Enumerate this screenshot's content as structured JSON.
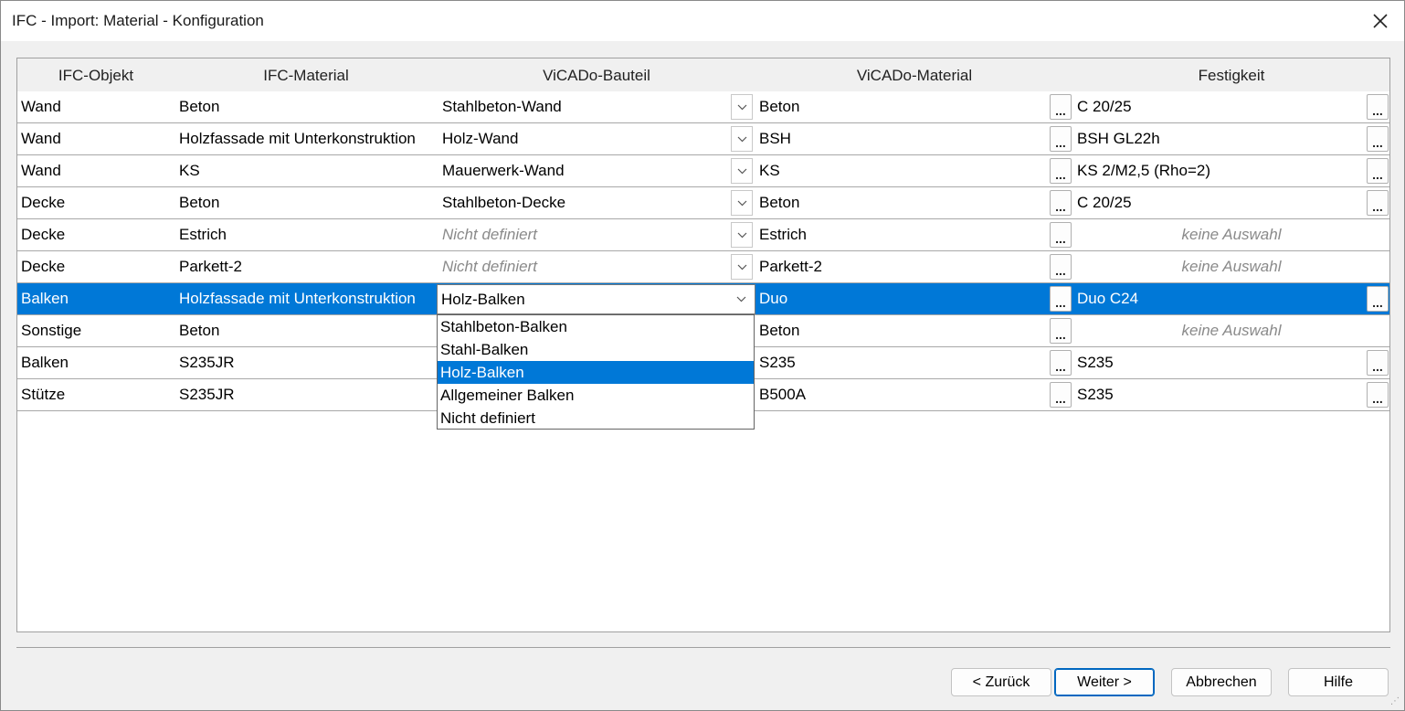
{
  "window": {
    "title": "IFC - Import: Material - Konfiguration"
  },
  "columns": [
    "IFC-Objekt",
    "IFC-Material",
    "ViCADo-Bauteil",
    "ViCADo-Material",
    "Festigkeit"
  ],
  "rows": [
    {
      "objekt": "Wand",
      "material": "Beton",
      "bauteil": "Stahlbeton-Wand",
      "bauteil_muted": false,
      "vmaterial": "Beton",
      "festigkeit": "C 20/25",
      "fest_muted": false,
      "fest_button": true
    },
    {
      "objekt": "Wand",
      "material": "Holzfassade mit Unterkonstruktion",
      "bauteil": "Holz-Wand",
      "bauteil_muted": false,
      "vmaterial": "BSH",
      "festigkeit": "BSH GL22h",
      "fest_muted": false,
      "fest_button": true
    },
    {
      "objekt": "Wand",
      "material": "KS",
      "bauteil": "Mauerwerk-Wand",
      "bauteil_muted": false,
      "vmaterial": "KS",
      "festigkeit": "KS 2/M2,5 (Rho=2)",
      "fest_muted": false,
      "fest_button": true
    },
    {
      "objekt": "Decke",
      "material": "Beton",
      "bauteil": "Stahlbeton-Decke",
      "bauteil_muted": false,
      "vmaterial": "Beton",
      "festigkeit": "C 20/25",
      "fest_muted": false,
      "fest_button": true
    },
    {
      "objekt": "Decke",
      "material": "Estrich",
      "bauteil": "Nicht definiert",
      "bauteil_muted": true,
      "vmaterial": "Estrich",
      "festigkeit": "keine Auswahl",
      "fest_muted": true,
      "fest_button": false
    },
    {
      "objekt": "Decke",
      "material": "Parkett-2",
      "bauteil": "Nicht definiert",
      "bauteil_muted": true,
      "vmaterial": "Parkett-2",
      "festigkeit": "keine Auswahl",
      "fest_muted": true,
      "fest_button": false
    },
    {
      "objekt": "Balken",
      "material": "Holzfassade mit Unterkonstruktion",
      "bauteil": "Holz-Balken",
      "bauteil_muted": false,
      "vmaterial": "Duo",
      "festigkeit": "Duo C24",
      "fest_muted": false,
      "fest_button": true,
      "selected": true
    },
    {
      "objekt": "Sonstige",
      "material": "Beton",
      "bauteil": "",
      "bauteil_muted": false,
      "vmaterial": "Beton",
      "festigkeit": "keine Auswahl",
      "fest_muted": true,
      "fest_button": false
    },
    {
      "objekt": "Balken",
      "material": "S235JR",
      "bauteil": "",
      "bauteil_muted": false,
      "vmaterial": "S235",
      "festigkeit": "S235",
      "fest_muted": false,
      "fest_button": true
    },
    {
      "objekt": "Stütze",
      "material": "S235JR",
      "bauteil": "",
      "bauteil_muted": false,
      "vmaterial": "B500A",
      "festigkeit": "S235",
      "fest_muted": false,
      "fest_button": true
    }
  ],
  "dropdown": {
    "options": [
      "Stahlbeton-Balken",
      "Stahl-Balken",
      "Holz-Balken",
      "Allgemeiner Balken",
      "Nicht definiert"
    ],
    "selected_index": 2
  },
  "buttons": {
    "back": "< Zurück",
    "next": "Weiter >",
    "cancel": "Abbrechen",
    "help": "Hilfe"
  },
  "icons": {
    "close": "close-icon",
    "combo_arrow": "chevron-down-icon",
    "resize": "resize-grip-icon"
  },
  "colors": {
    "selection": "#0078d7",
    "muted": "#8a8a8a"
  }
}
